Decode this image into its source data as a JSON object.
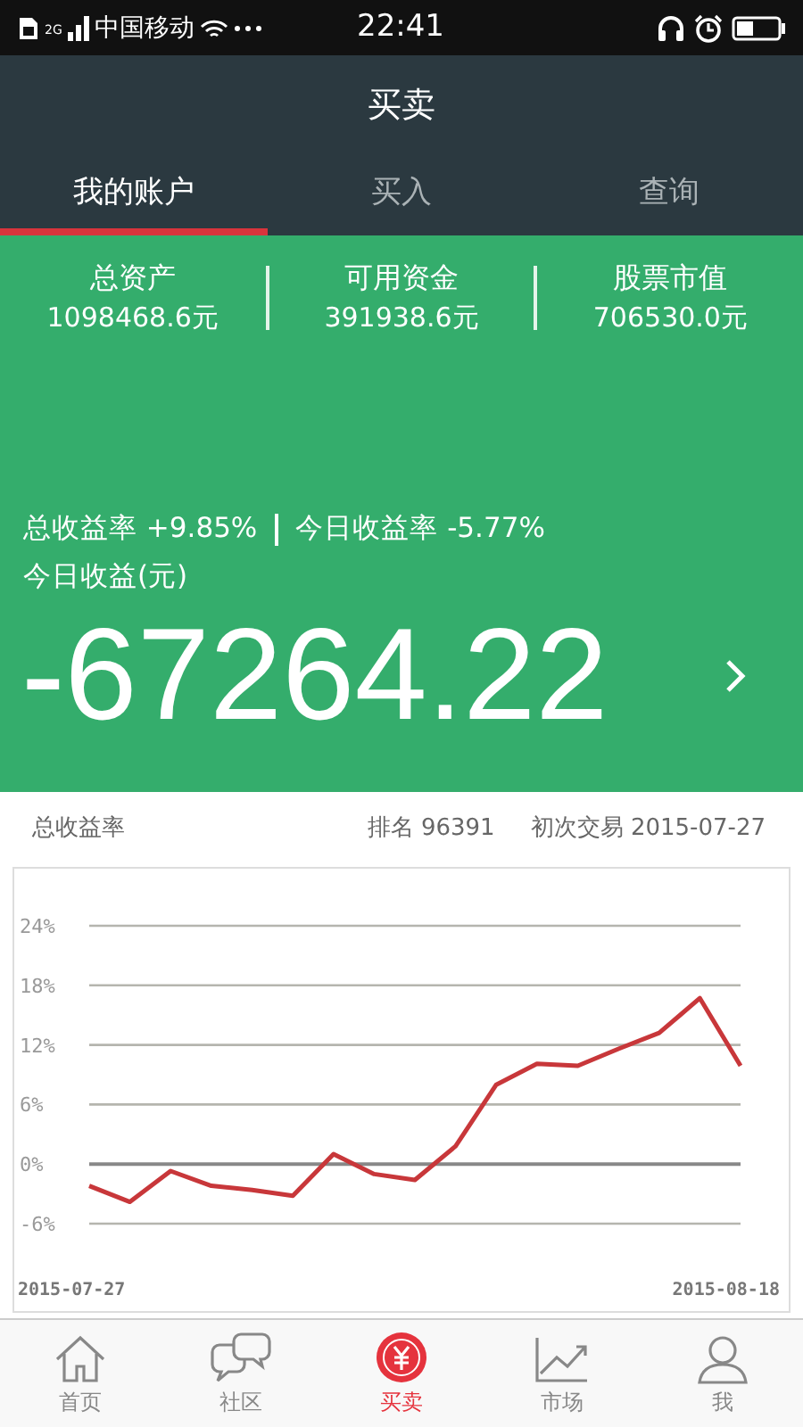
{
  "status_bar": {
    "network": "2G",
    "carrier": "中国移动",
    "time": "22:41"
  },
  "header": {
    "title": "买卖"
  },
  "tabs": [
    {
      "label": "我的账户",
      "selected": true
    },
    {
      "label": "买入",
      "selected": false
    },
    {
      "label": "查询",
      "selected": false
    }
  ],
  "account": {
    "stats": [
      {
        "label": "总资产",
        "value": "1098468.6元"
      },
      {
        "label": "可用资金",
        "value": "391938.6元"
      },
      {
        "label": "股票市值",
        "value": "706530.0元"
      }
    ],
    "total_return": "总收益率 +9.85%",
    "today_return": "今日收益率 -5.77%",
    "today_profit_label": "今日收益(元)",
    "today_profit": "-67264.22"
  },
  "summary": {
    "title": "总收益率",
    "rank": "排名 96391",
    "first_trade": "初次交易 2015-07-27"
  },
  "chart_data": {
    "type": "line",
    "categories": [
      "2015-07-27",
      null,
      null,
      null,
      null,
      null,
      null,
      null,
      null,
      null,
      null,
      null,
      null,
      null,
      null,
      null,
      "2015-08-18"
    ],
    "series": [
      {
        "color": "#c8373a",
        "values": [
          -2.2,
          -3.8,
          -0.7,
          -2.2,
          -2.6,
          -3.2,
          1.0,
          -1.0,
          -1.6,
          1.8,
          8.0,
          10.1,
          9.9,
          11.6,
          13.2,
          16.7,
          9.9
        ]
      }
    ],
    "ylim": [
      -6,
      24
    ],
    "grid": true,
    "yticks": [
      {
        "value": 24,
        "label": "24%"
      },
      {
        "value": 18,
        "label": "18%"
      },
      {
        "value": 12,
        "label": "12%"
      },
      {
        "value": 6,
        "label": "6%"
      },
      {
        "value": 0,
        "label": "0%"
      },
      {
        "value": -6,
        "label": "-6%"
      }
    ]
  },
  "nav": [
    {
      "label": "首页",
      "selected": false
    },
    {
      "label": "社区",
      "selected": false
    },
    {
      "label": "买卖",
      "selected": true
    },
    {
      "label": "市场",
      "selected": false
    },
    {
      "label": "我",
      "selected": false
    }
  ]
}
